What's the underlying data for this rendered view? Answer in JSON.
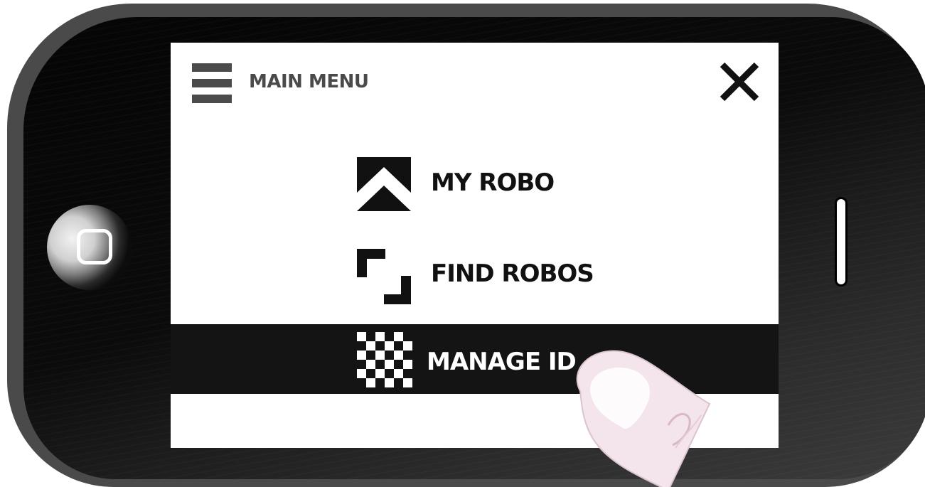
{
  "header": {
    "title": "MAIN MENU"
  },
  "menu": {
    "items": [
      {
        "label": "MY ROBO",
        "icon": "chevron-up-icon",
        "selected": false
      },
      {
        "label": "FIND ROBOS",
        "icon": "scan-corners-icon",
        "selected": false
      },
      {
        "label": "MANAGE ID",
        "icon": "checkerboard-icon",
        "selected": true
      }
    ]
  },
  "colors": {
    "selected_row": "#141414",
    "header_text": "#4a4a4a",
    "item_text": "#111111"
  }
}
